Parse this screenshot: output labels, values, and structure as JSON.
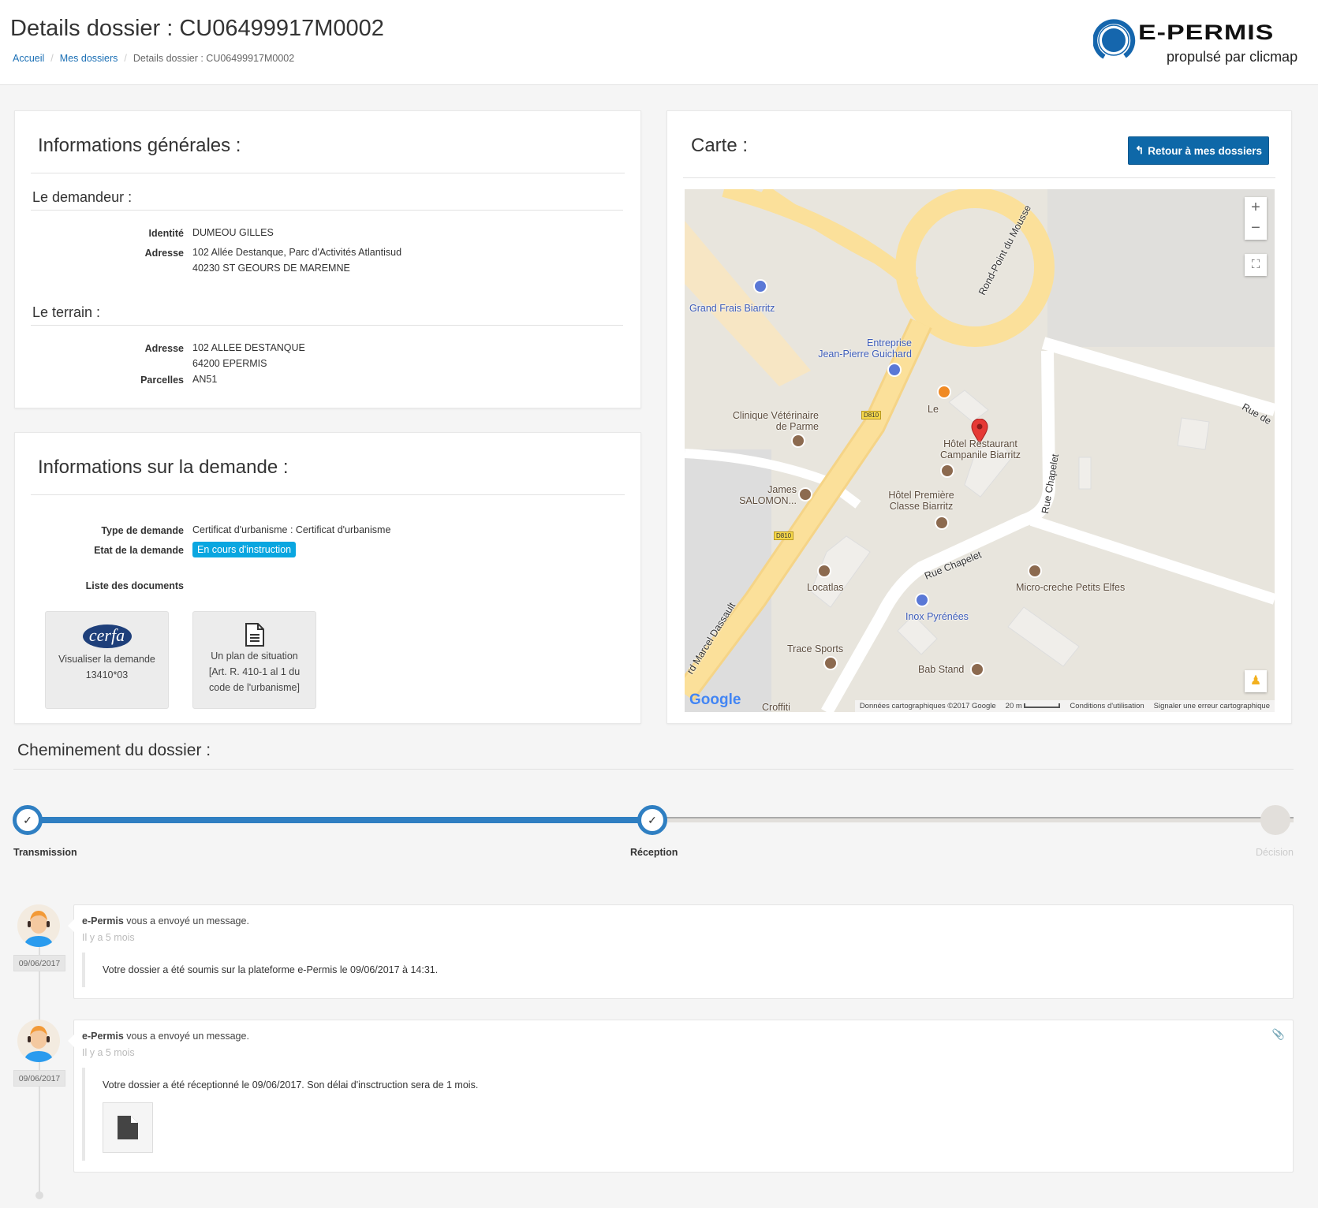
{
  "header": {
    "title": "Details dossier : CU06499917M0002",
    "breadcrumb": [
      "Accueil",
      "Mes dossiers",
      "Details dossier : CU06499917M0002"
    ],
    "logo_text": "E-PERMIS",
    "logo_tagline": "propulsé par clicmap",
    "brand_color": "#0e68a8"
  },
  "general": {
    "title": "Informations générales :",
    "applicant": {
      "title": "Le demandeur :",
      "identity_label": "Identité",
      "identity": "DUMEOU GILLES",
      "address_label": "Adresse",
      "address_line1": "102 Allée Destanque, Parc d'Activités Atlantisud",
      "address_line2": "40230 ST GEOURS DE MAREMNE"
    },
    "land": {
      "title": "Le terrain :",
      "address_label": "Adresse",
      "address_line1": "102 ALLEE DESTANQUE",
      "address_line2": "64200 EPERMIS",
      "parcels_label": "Parcelles",
      "parcels": "AN51"
    }
  },
  "request": {
    "title": "Informations sur la demande :",
    "type_label": "Type de demande",
    "type": "Certificat d'urbanisme : Certificat d'urbanisme",
    "state_label": "Etat de la demande",
    "state": "En cours d'instruction",
    "state_color": "#0aa6e0",
    "documents_label": "Liste des documents",
    "documents": [
      {
        "icon": "cerfa-logo",
        "logo_text": "cerfa",
        "line1": "Visualiser la demande",
        "line2": "13410*03"
      },
      {
        "icon": "file-text-icon",
        "line1": "Un plan de situation",
        "line2": "[Art. R. 410-1 al 1 du",
        "line3": "code de l'urbanisme]"
      }
    ]
  },
  "map_panel": {
    "title": "Carte :",
    "back_button": "Retour à mes dossiers",
    "labels": {
      "grand_frais": "Grand Frais Biarritz",
      "guichard1": "Entreprise",
      "guichard2": "Jean-Pierre Guichard",
      "rond_point": "Rond-Point du Mousse",
      "clinique1": "Clinique Vétérinaire",
      "clinique2": "de Parme",
      "le": "Le",
      "campanile1": "Hôtel Restaurant",
      "campanile2": "Campanile Biarritz",
      "premiere1": "Hôtel Première",
      "premiere2": "Classe Biarritz",
      "james1": "James",
      "james2": "SALOMON...",
      "rue_chapelet": "Rue Chapelet",
      "rue_chapelet_v": "Rue Chapelet",
      "locatlas": "Locatlas",
      "micro": "Micro-creche Petits Elfes",
      "inox": "Inox Pyrénées",
      "trace": "Trace Sports",
      "bab": "Bab Stand",
      "dassault": "rd Marcel Dassault",
      "rue_de": "Rue de",
      "croffiti": "Croffiti",
      "d810": "D810"
    },
    "zoom_in": "+",
    "zoom_out": "−",
    "google": "Google",
    "attribution": "Données cartographiques ©2017 Google",
    "scale": "20 m",
    "terms": "Conditions d'utilisation",
    "report": "Signaler une erreur cartographique"
  },
  "progress": {
    "title": "Cheminement du dossier :",
    "steps": [
      {
        "label": "Transmission",
        "done": true
      },
      {
        "label": "Réception",
        "done": true
      },
      {
        "label": "Décision",
        "done": false
      }
    ],
    "active_color": "#2f7fc2"
  },
  "messages": [
    {
      "date": "09/06/2017",
      "sender": "e-Permis",
      "action": " vous a envoyé un message.",
      "time": "Il y a 5 mois",
      "body": "Votre dossier a été soumis sur la plateforme e-Permis le 09/06/2017 à 14:31."
    },
    {
      "date": "09/06/2017",
      "sender": "e-Permis",
      "action": " vous a envoyé un message.",
      "time": "Il y a 5 mois",
      "body": "Votre dossier a été réceptionné le 09/06/2017. Son délai d'insctruction sera de 1 mois.",
      "attachment": "file-icon"
    }
  ]
}
